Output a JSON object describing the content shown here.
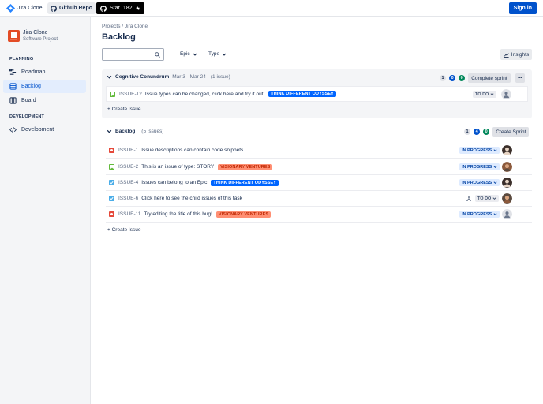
{
  "topbar": {
    "app_name": "Jira Clone",
    "github_label": "Github Repo",
    "star_label": "Star",
    "star_count": "182",
    "signin_label": "Sign in"
  },
  "sidebar": {
    "project_name": "Jira Clone",
    "project_type": "Software Project",
    "section_planning": "PLANNING",
    "section_development": "DEVELOPMENT",
    "items": [
      {
        "label": "Roadmap"
      },
      {
        "label": "Backlog"
      },
      {
        "label": "Board"
      },
      {
        "label": "Development"
      }
    ]
  },
  "main": {
    "breadcrumb": "Projects / Jira Clone",
    "title": "Backlog",
    "search_placeholder": "",
    "filter_epic": "Epic",
    "filter_type": "Type",
    "insights_label": "Insights"
  },
  "sprint": {
    "name": "Cognitive Conundrum",
    "dates": "Mar 3 - Mar 24",
    "count_label": "(1 issue)",
    "counts": [
      "1",
      "0",
      "0"
    ],
    "action_label": "Complete sprint",
    "more_label": "•••",
    "issues": [
      {
        "key": "ISSUE-12",
        "summary": "Issue types can be changed, click here and try it out!",
        "epic": "THINK DIFFERENT ODYSSEY",
        "status": "TO DO"
      }
    ],
    "create_label": "+ Create Issue"
  },
  "backlog": {
    "name": "Backlog",
    "count_label": "(5 issues)",
    "counts": [
      "1",
      "4",
      "0"
    ],
    "action_label": "Create Sprint",
    "issues": [
      {
        "key": "ISSUE-1",
        "summary": "Issue descriptions can contain code snippets",
        "epic": "",
        "status": "IN PROGRESS"
      },
      {
        "key": "ISSUE-2",
        "summary": "This is an issue of type: STORY",
        "epic": "VISIONARY VENTURES",
        "status": "IN PROGRESS"
      },
      {
        "key": "ISSUE-4",
        "summary": "Issues can belong to an Epic",
        "epic": "THINK DIFFERENT ODYSSEY",
        "status": "IN PROGRESS"
      },
      {
        "key": "ISSUE-6",
        "summary": "Click here to see the child issues of this task",
        "epic": "",
        "status": "TO DO"
      },
      {
        "key": "ISSUE-11",
        "summary": "Try editing the title of this bug!",
        "epic": "VISIONARY VENTURES",
        "status": "IN PROGRESS"
      }
    ],
    "create_label": "+ Create Issue"
  },
  "colors": {
    "primary": "#0052cc",
    "story": "#63ba3c",
    "bug": "#e5493a",
    "task": "#4bade8"
  }
}
